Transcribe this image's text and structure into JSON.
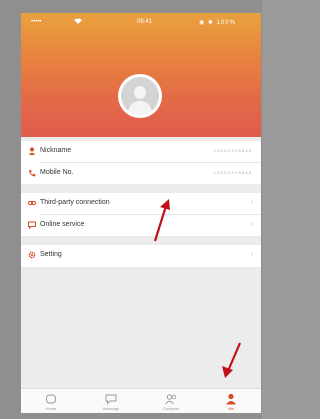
{
  "status_bar": {
    "signal": "••••• ",
    "time": "09:41",
    "right_icons": "◉ ✱ 100%"
  },
  "profile": {
    "rows": [
      {
        "icon": "person-icon",
        "label": "Nickname",
        "value": "1 3 5 X X X X 6 6 6 6"
      },
      {
        "icon": "phone-icon",
        "label": "Mobile No.",
        "value": "1 3 5 X X X X 6 6 6 6"
      }
    ]
  },
  "services": {
    "rows": [
      {
        "icon": "link-icon",
        "label": "Third-party connection",
        "chevron": "›"
      },
      {
        "icon": "chat-icon",
        "label": "Online service",
        "chevron": "›"
      }
    ]
  },
  "settings": {
    "rows": [
      {
        "icon": "gear-icon",
        "label": "Setting",
        "chevron": "›"
      }
    ]
  },
  "tabbar": {
    "tabs": [
      {
        "icon": "home-icon",
        "label": "Home",
        "active": false
      },
      {
        "icon": "message-icon",
        "label": "Message",
        "active": false
      },
      {
        "icon": "contacts-icon",
        "label": "Contacts",
        "active": false
      },
      {
        "icon": "me-icon",
        "label": "Me",
        "active": true
      }
    ]
  },
  "colors": {
    "accent": "#d84a2a",
    "header_gradient_top": "#e9a13e",
    "header_gradient_bottom": "#e05c4d",
    "annotation_arrow": "#c0101a"
  }
}
